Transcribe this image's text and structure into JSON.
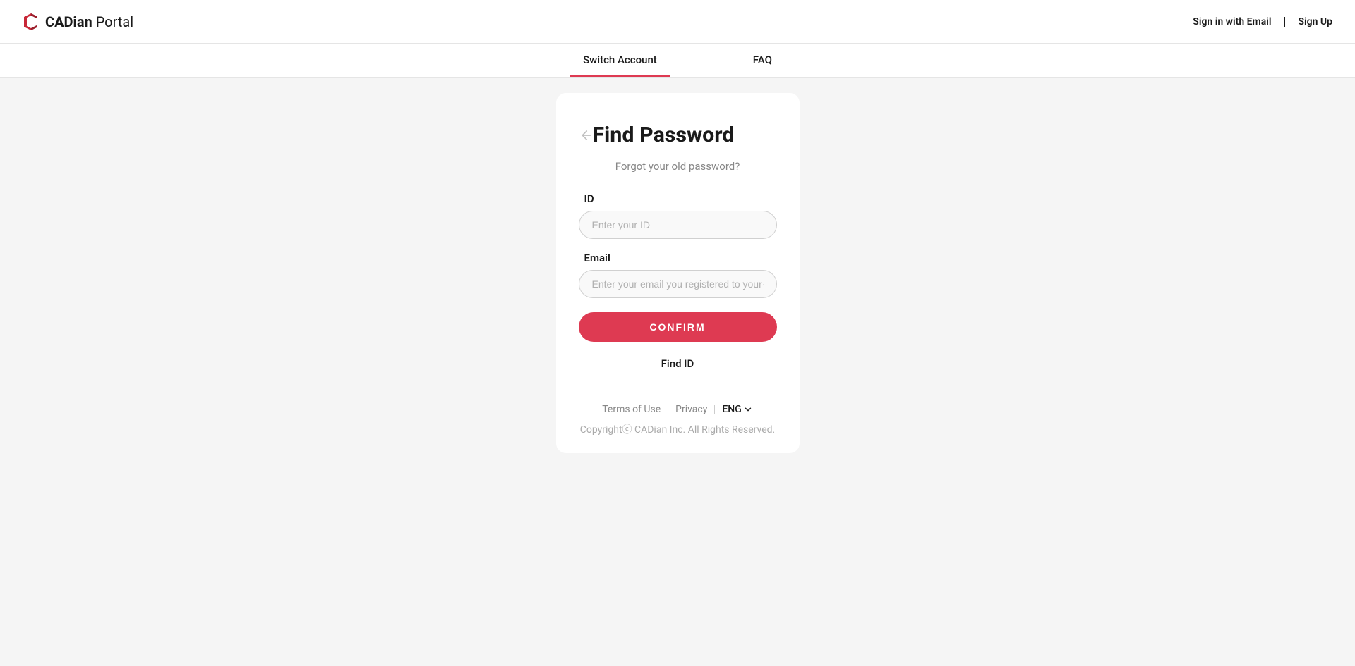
{
  "header": {
    "brand_bold": "CADian",
    "brand_light": " Portal",
    "signin_label": "Sign in with Email",
    "signup_label": "Sign Up"
  },
  "tabs": {
    "switch_account": "Switch Account",
    "faq": "FAQ"
  },
  "card": {
    "title": "Find Password",
    "subtitle": "Forgot your old password?",
    "id_label": "ID",
    "id_placeholder": "Enter your ID",
    "email_label": "Email",
    "email_placeholder": "Enter your email you registered to your···",
    "confirm_label": "CONFIRM",
    "find_id_label": "Find ID"
  },
  "footer": {
    "terms": "Terms of Use",
    "privacy": "Privacy",
    "lang": "ENG",
    "copyright": "Copyrightⓒ CADian Inc. All Rights Reserved."
  },
  "colors": {
    "primary": "#de3a52"
  }
}
